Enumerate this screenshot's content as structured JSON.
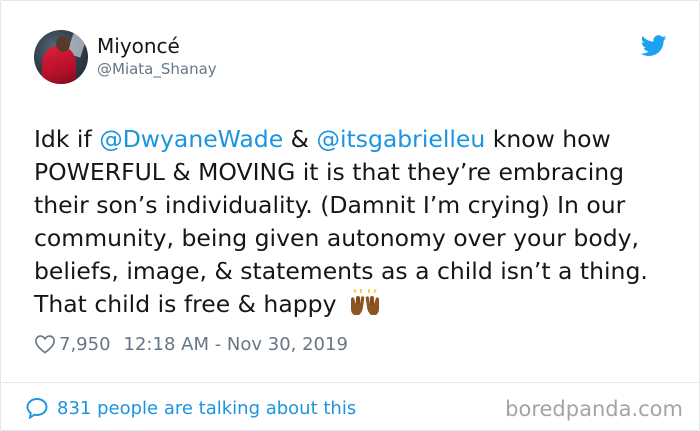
{
  "tweet": {
    "display_name": "Miyoncé",
    "handle": "@Miata_Shanay",
    "text_parts": {
      "p1": "Idk if ",
      "m1": "@DwyaneWade",
      "p2": " & ",
      "m2": "@itsgabrielleu",
      "p3": " know how POWERFUL & MOVING it is that they’re embracing their son’s individuality. (Damnit I’m crying) In our community, being given autonomy over your body, beliefs, image, & statements as a child isn’t a thing. That child is free & happy "
    },
    "emoji": "raising-hands-emoji",
    "likes": "7,950",
    "timestamp": "12:18 AM - Nov 30, 2019",
    "talking_about": "831 people are talking about this"
  },
  "watermark": "boredpanda.com",
  "colors": {
    "link": "#1b95e0",
    "text": "#14171a",
    "muted": "#657786",
    "border": "#e1e8ed"
  },
  "icons": {
    "brand": "twitter-bird-icon",
    "like": "heart-icon",
    "reply": "speech-bubble-icon"
  }
}
